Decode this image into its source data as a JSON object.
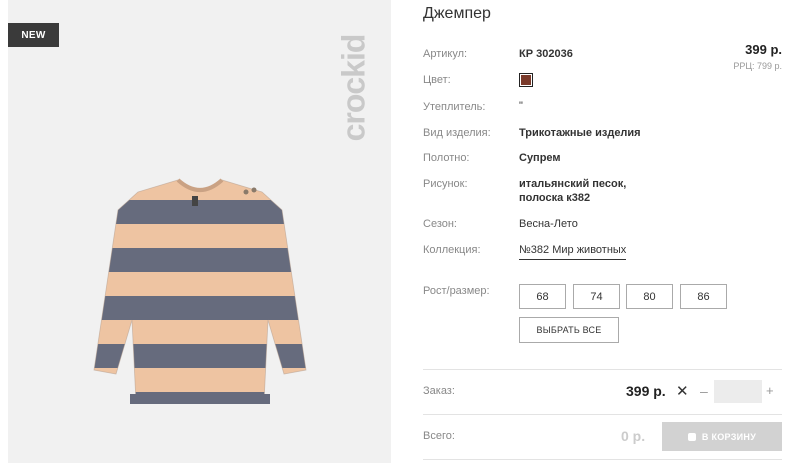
{
  "product": {
    "badge": "NEW",
    "brand": "crockid",
    "title": "Джемпер",
    "price": "399 р.",
    "rrp": "РРЦ: 799 р."
  },
  "attributes": {
    "article_label": "Артикул:",
    "article_value": "КР 302036",
    "color_label": "Цвет:",
    "color_swatch": "#7a3a2a",
    "insulation_label": "Утеплитель:",
    "insulation_value": "\"",
    "type_label": "Вид изделия:",
    "type_value": "Трикотажные изделия",
    "fabric_label": "Полотно:",
    "fabric_value": "Супрем",
    "pattern_label": "Рисунок:",
    "pattern_line1": "итальянский песок,",
    "pattern_line2": "полоска к382",
    "season_label": "Сезон:",
    "season_value": "Весна-Лето",
    "collection_label": "Коллекция:",
    "collection_value": "№382 Мир животных"
  },
  "sizes": {
    "label": "Рост/размер:",
    "options": [
      "68",
      "74",
      "80",
      "86"
    ],
    "select_all": "ВЫБРАТЬ ВСЕ"
  },
  "order": {
    "label": "Заказ:",
    "price": "399 р.",
    "times": "✕",
    "minus": "–",
    "plus": "+",
    "quantity": ""
  },
  "total": {
    "label": "Всего:",
    "price": "0 р.",
    "cart_button": "В КОРЗИНУ"
  },
  "colors": {
    "stripe_peach": "#eec4a2",
    "stripe_gray": "#666b7d"
  }
}
